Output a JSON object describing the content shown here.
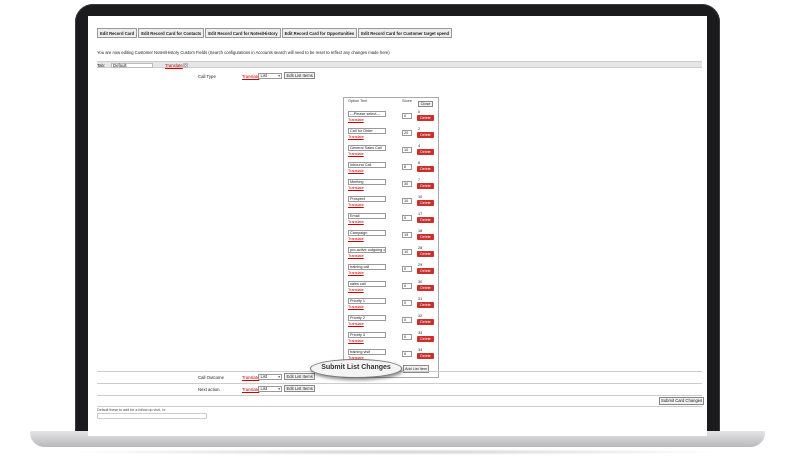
{
  "tabs": [
    "Edit Record Card",
    "Edit Record Card for Contacts",
    "Edit Record Card for Notes/History",
    "Edit Record Card for Opportunities",
    "Edit Record Card for Customer target spend"
  ],
  "info_text": "You are now editing Customer Notes/History Custom Fields (Search configurations in Accounts search will need to be reset to reflect any changes made here)",
  "tab_bar": {
    "tab_label": "Tab:",
    "tab_value": "Default",
    "translate": "Translate",
    "box_value": "0"
  },
  "fields": [
    {
      "label": "Call Type",
      "translate": "Translate",
      "select": "List",
      "button": "Edit List Items"
    },
    {
      "label": "Call Outcome",
      "translate": "Translate",
      "select": "List",
      "button": "Edit List Items"
    },
    {
      "label": "Next action",
      "translate": "Translate",
      "select": "List",
      "button": "Edit List Items"
    }
  ],
  "list_editor": {
    "col_option_text": "Option Text",
    "col_score": "Score",
    "close_label": "Close",
    "add_label": "Add List Item",
    "translate_label": "Translate",
    "delete_label": "Delete",
    "items": [
      {
        "text": "---Please select---",
        "score": "0",
        "num": "0"
      },
      {
        "text": "Call for Order",
        "score": "20",
        "num": "2"
      },
      {
        "text": "General Sales Call",
        "score": "10",
        "num": "4"
      },
      {
        "text": "Inbound Call",
        "score": "8",
        "num": "6"
      },
      {
        "text": "Meeting",
        "score": "30",
        "num": "7"
      },
      {
        "text": "Prospect",
        "score": "10",
        "num": "10"
      },
      {
        "text": "Email",
        "score": "5",
        "num": "17"
      },
      {
        "text": "Campaign",
        "score": "15",
        "num": "18"
      },
      {
        "text": "pro-active outgoing call",
        "score": "10",
        "num": "28"
      },
      {
        "text": "training call",
        "score": "0",
        "num": "29"
      },
      {
        "text": "sales call",
        "score": "0",
        "num": "30"
      },
      {
        "text": "Priority 1",
        "score": "0",
        "num": "31"
      },
      {
        "text": "Priority 2",
        "score": "0",
        "num": "32"
      },
      {
        "text": "Priority 3",
        "score": "0",
        "num": "33"
      },
      {
        "text": "training visit",
        "score": "0",
        "num": "34"
      }
    ]
  },
  "submit_list_label": "Submit List Changes",
  "submit_card_label": "Submit Card Changes",
  "footnote": "Default these to add for a follow up visit, i.e"
}
